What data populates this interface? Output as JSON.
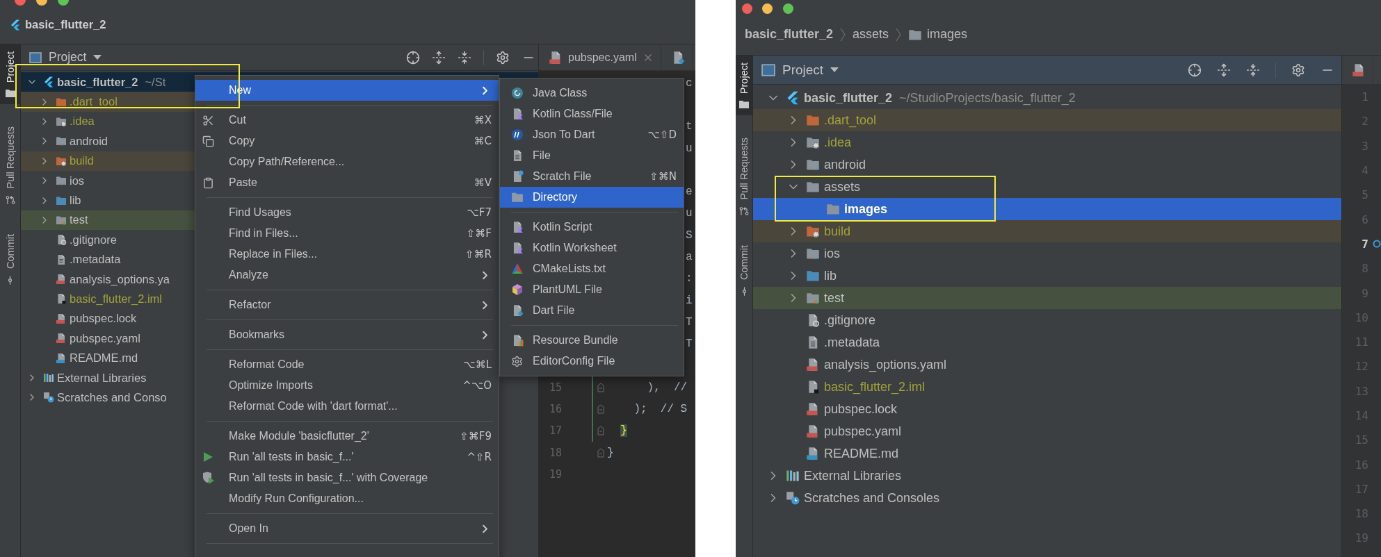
{
  "left_window": {
    "title": "basic_flutter_2",
    "tool_strip": [
      {
        "label": "Project",
        "selected": true,
        "kind": "project"
      },
      {
        "label": "Pull Requests",
        "selected": false,
        "kind": "pulls"
      },
      {
        "label": "Commit",
        "selected": false,
        "kind": "commit"
      }
    ],
    "project_pane": {
      "title": "Project",
      "focused": false,
      "tree": [
        {
          "label": "basic_flutter_2",
          "path": "~/St",
          "kind": "project",
          "expanded": true,
          "selected": true,
          "framed": true,
          "ignored": false,
          "children": [
            {
              "label": ".dart_tool",
              "kind": "excluded-folder",
              "expanded": false,
              "selected": false,
              "framed": true,
              "ignored": true
            },
            {
              "label": ".idea",
              "kind": "settings-folder",
              "expanded": false,
              "selected": false,
              "ignored": true
            },
            {
              "label": "android",
              "kind": "platform-folder",
              "expanded": false,
              "selected": false,
              "ignored": false
            },
            {
              "label": "build",
              "kind": "excluded-settings-folder",
              "expanded": false,
              "selected": false,
              "ignored": true
            },
            {
              "label": "ios",
              "kind": "platform-folder",
              "expanded": false,
              "selected": false,
              "ignored": false
            },
            {
              "label": "lib",
              "kind": "source-folder",
              "expanded": false,
              "selected": false,
              "ignored": false
            },
            {
              "label": "test",
              "kind": "test-folder",
              "expanded": false,
              "selected": false,
              "ignored": false
            },
            {
              "label": ".gitignore",
              "kind": "ignore-file",
              "selected": false,
              "ignored": false
            },
            {
              "label": ".metadata",
              "kind": "text-file",
              "selected": false,
              "ignored": false
            },
            {
              "label": "analysis_options.ya",
              "kind": "yaml-file",
              "selected": false,
              "ignored": false
            },
            {
              "label": "basic_flutter_2.iml",
              "kind": "iml-file",
              "selected": false,
              "ignored": true
            },
            {
              "label": "pubspec.lock",
              "kind": "yaml-file",
              "selected": false,
              "ignored": false
            },
            {
              "label": "pubspec.yaml",
              "kind": "yaml-file",
              "selected": false,
              "ignored": false
            },
            {
              "label": "README.md",
              "kind": "markdown-file",
              "selected": false,
              "ignored": false
            }
          ]
        },
        {
          "label": "External Libraries",
          "kind": "libraries",
          "expanded": false,
          "selected": false,
          "ignored": false
        },
        {
          "label": "Scratches and Conso",
          "kind": "scratches",
          "expanded": false,
          "selected": false,
          "ignored": false
        }
      ]
    },
    "editor": {
      "tabs": [
        {
          "label": "pubspec.yaml",
          "kind": "yaml",
          "closable": true
        },
        {
          "kind": "dart",
          "closable": false
        }
      ],
      "lines": [
        {
          "kind": "tail",
          "code": "c"
        },
        {
          "kind": "blank"
        },
        {
          "kind": "tail",
          "code": "t"
        },
        {
          "kind": "tail",
          "code": "u"
        },
        {
          "kind": "blank"
        },
        {
          "kind": "tail",
          "code": "e"
        },
        {
          "kind": "tail",
          "code": "u"
        },
        {
          "kind": "tail",
          "code": "S"
        },
        {
          "kind": "tail",
          "code": "a"
        },
        {
          "kind": "tail",
          "code": ":"
        },
        {
          "kind": "tail",
          "code": "i"
        },
        {
          "kind": "tail",
          "code": "T"
        },
        {
          "kind": "tail",
          "code": "T"
        },
        {
          "kind": "blank"
        },
        {
          "kind": "numbered",
          "number": "15",
          "code": "      ),  //",
          "fold_marker": true,
          "changed": true,
          "matched": false
        },
        {
          "kind": "numbered",
          "number": "16",
          "code": "    );  // S",
          "fold_marker": true,
          "changed": true,
          "matched": false
        },
        {
          "kind": "numbered",
          "number": "17",
          "code": "  }",
          "fold_marker": true,
          "changed": true,
          "matched": true
        },
        {
          "kind": "numbered",
          "number": "18",
          "code": "}",
          "fold_marker": true,
          "matched": false
        },
        {
          "kind": "numbered",
          "number": "19",
          "fold_marker": false
        }
      ]
    },
    "context_menu": {
      "items": [
        {
          "kind": "plain",
          "label": "New",
          "submenu": true,
          "selected": true
        },
        {
          "kind": "separator"
        },
        {
          "kind": "cut",
          "label": "Cut",
          "shortcut": "⌘X",
          "submenu": false,
          "selected": false
        },
        {
          "kind": "copy",
          "label": "Copy",
          "shortcut": "⌘C",
          "submenu": false,
          "selected": false
        },
        {
          "kind": "plain",
          "label": "Copy Path/Reference...",
          "submenu": false,
          "selected": false
        },
        {
          "kind": "paste",
          "label": "Paste",
          "shortcut": "⌘V",
          "submenu": false,
          "selected": false
        },
        {
          "kind": "separator"
        },
        {
          "kind": "plain",
          "label": "Find Usages",
          "shortcut": "⌥F7",
          "submenu": false,
          "selected": false
        },
        {
          "kind": "plain",
          "label": "Find in Files...",
          "shortcut": "⇧⌘F",
          "submenu": false,
          "selected": false
        },
        {
          "kind": "plain",
          "label": "Replace in Files...",
          "shortcut": "⇧⌘R",
          "submenu": false,
          "selected": false
        },
        {
          "kind": "plain",
          "label": "Analyze",
          "submenu": true,
          "selected": false
        },
        {
          "kind": "separator"
        },
        {
          "kind": "plain",
          "label": "Refactor",
          "submenu": true,
          "selected": false
        },
        {
          "kind": "separator"
        },
        {
          "kind": "plain",
          "label": "Bookmarks",
          "submenu": true,
          "selected": false
        },
        {
          "kind": "separator"
        },
        {
          "kind": "plain",
          "label": "Reformat Code",
          "shortcut": "⌥⌘L",
          "submenu": false,
          "selected": false
        },
        {
          "kind": "plain",
          "label": "Optimize Imports",
          "shortcut": "^⌥O",
          "submenu": false,
          "selected": false
        },
        {
          "kind": "plain",
          "label": "Reformat Code with 'dart format'...",
          "submenu": false,
          "selected": false
        },
        {
          "kind": "separator"
        },
        {
          "kind": "plain",
          "label": "Make Module 'basicflutter_2'",
          "shortcut": "⇧⌘F9",
          "submenu": false,
          "selected": false
        },
        {
          "kind": "run",
          "label": "Run 'all tests in basic_f...'",
          "shortcut": "^⇧R",
          "submenu": false,
          "selected": false
        },
        {
          "kind": "coverage",
          "label": "Run 'all tests in basic_f...' with Coverage",
          "submenu": false,
          "selected": false
        },
        {
          "kind": "plain",
          "label": "Modify Run Configuration...",
          "submenu": false,
          "selected": false
        },
        {
          "kind": "separator"
        },
        {
          "kind": "plain",
          "label": "Open In",
          "submenu": true,
          "selected": false
        },
        {
          "kind": "separator"
        }
      ]
    },
    "submenu": {
      "items": [
        {
          "kind": "java",
          "label": "Java Class",
          "selected": false
        },
        {
          "kind": "kotlin",
          "label": "Kotlin Class/File",
          "selected": false
        },
        {
          "kind": "json",
          "label": "Json To Dart",
          "shortcut": "⌥⇧D",
          "selected": false
        },
        {
          "kind": "file",
          "label": "File",
          "selected": false
        },
        {
          "kind": "scratch",
          "label": "Scratch File",
          "shortcut": "⇧⌘N",
          "selected": false
        },
        {
          "kind": "directory",
          "label": "Directory",
          "selected": true
        },
        {
          "kind": "separator"
        },
        {
          "kind": "kotlin",
          "label": "Kotlin Script",
          "selected": false
        },
        {
          "kind": "kotlin",
          "label": "Kotlin Worksheet",
          "selected": false
        },
        {
          "kind": "cmake",
          "label": "CMakeLists.txt",
          "selected": false
        },
        {
          "kind": "plantuml",
          "label": "PlantUML File",
          "selected": false
        },
        {
          "kind": "dart",
          "label": "Dart File",
          "selected": false
        },
        {
          "kind": "separator"
        },
        {
          "kind": "bundle",
          "label": "Resource Bundle",
          "selected": false
        },
        {
          "kind": "editorconfig",
          "label": "EditorConfig File",
          "selected": false
        }
      ]
    }
  },
  "right_window": {
    "breadcrumb": [
      {
        "label": "basic_flutter_2",
        "kind": "root"
      },
      {
        "label": "assets",
        "kind": "plain"
      },
      {
        "label": "images",
        "kind": "folder"
      }
    ],
    "tool_strip": [
      {
        "label": "Project",
        "selected": true,
        "kind": "project"
      },
      {
        "label": "Pull Requests",
        "selected": false,
        "kind": "pulls"
      },
      {
        "label": "Commit",
        "selected": false,
        "kind": "commit"
      }
    ],
    "project_pane": {
      "title": "Project",
      "focused": true,
      "tree": [
        {
          "label": "basic_flutter_2",
          "path": "~/StudioProjects/basic_flutter_2",
          "kind": "project",
          "expanded": true,
          "selected": false,
          "ignored": false,
          "children": [
            {
              "label": ".dart_tool",
              "kind": "excluded-folder",
              "expanded": false,
              "selected": false,
              "ignored": true
            },
            {
              "label": ".idea",
              "kind": "settings-folder",
              "expanded": false,
              "selected": false,
              "ignored": true
            },
            {
              "label": "android",
              "kind": "platform-folder",
              "expanded": false,
              "selected": false,
              "ignored": false
            },
            {
              "label": "assets",
              "kind": "folder",
              "expanded": true,
              "selected": false,
              "framed": true,
              "ignored": false,
              "children": [
                {
                  "label": "images",
                  "kind": "folder",
                  "selected": true,
                  "framed": true,
                  "ignored": false
                }
              ]
            },
            {
              "label": "build",
              "kind": "excluded-settings-folder",
              "expanded": false,
              "selected": false,
              "ignored": true
            },
            {
              "label": "ios",
              "kind": "platform-folder",
              "expanded": false,
              "selected": false,
              "ignored": false
            },
            {
              "label": "lib",
              "kind": "source-folder",
              "expanded": false,
              "selected": false,
              "ignored": false
            },
            {
              "label": "test",
              "kind": "test-folder",
              "expanded": false,
              "selected": false,
              "ignored": false
            },
            {
              "label": ".gitignore",
              "kind": "ignore-file",
              "selected": false,
              "ignored": false
            },
            {
              "label": ".metadata",
              "kind": "text-file",
              "selected": false,
              "ignored": false
            },
            {
              "label": "analysis_options.yaml",
              "kind": "yaml-file",
              "selected": false,
              "ignored": false
            },
            {
              "label": "basic_flutter_2.iml",
              "kind": "iml-file",
              "selected": false,
              "ignored": true
            },
            {
              "label": "pubspec.lock",
              "kind": "yaml-file",
              "selected": false,
              "ignored": false
            },
            {
              "label": "pubspec.yaml",
              "kind": "yaml-file",
              "selected": false,
              "ignored": false
            },
            {
              "label": "README.md",
              "kind": "markdown-file",
              "selected": false,
              "ignored": false
            }
          ]
        },
        {
          "label": "External Libraries",
          "kind": "libraries",
          "expanded": false,
          "selected": false,
          "ignored": false
        },
        {
          "label": "Scratches and Consoles",
          "kind": "scratches",
          "expanded": false,
          "selected": false,
          "ignored": false
        }
      ]
    },
    "editor": {
      "tabs": [
        {
          "kind": "yaml",
          "closable": false
        }
      ],
      "lines": [
        {
          "number": "1",
          "current": false,
          "marker": false
        },
        {
          "number": "2",
          "current": false,
          "marker": false
        },
        {
          "number": "3",
          "current": false,
          "marker": false
        },
        {
          "number": "4",
          "current": false,
          "marker": false
        },
        {
          "number": "5",
          "current": false,
          "marker": false
        },
        {
          "number": "6",
          "current": false,
          "marker": false
        },
        {
          "number": "7",
          "current": true,
          "marker": true
        },
        {
          "number": "8",
          "current": false,
          "marker": false
        },
        {
          "number": "9",
          "current": false,
          "marker": false
        },
        {
          "number": "10",
          "current": false,
          "marker": false
        },
        {
          "number": "11",
          "current": false,
          "marker": false
        },
        {
          "number": "12",
          "current": false,
          "marker": false
        },
        {
          "number": "13",
          "current": false,
          "marker": false
        },
        {
          "number": "14",
          "current": false,
          "marker": false
        },
        {
          "number": "15",
          "current": false,
          "marker": false
        },
        {
          "number": "16",
          "current": false,
          "marker": false
        },
        {
          "number": "17",
          "current": false,
          "marker": false
        },
        {
          "number": "18",
          "current": false,
          "marker": false
        },
        {
          "number": "19",
          "current": false,
          "marker": false
        }
      ]
    }
  }
}
